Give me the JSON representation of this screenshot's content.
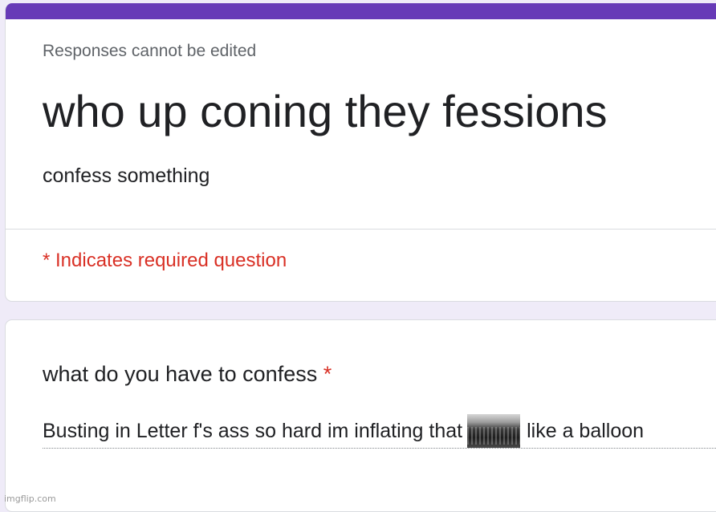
{
  "form": {
    "accent_color": "#673ab7",
    "edit_notice": "Responses cannot be edited",
    "title": "who up coning they fessions",
    "description": "confess something",
    "required_note": "* Indicates required question"
  },
  "question": {
    "label": "what do you have to confess",
    "required_marker": "*",
    "answer_text_before": "Busting in Letter f's ass so hard im inflating that",
    "answer_image": "inline-image",
    "answer_text_after": "like a balloon"
  },
  "watermark": "imgflip.com"
}
